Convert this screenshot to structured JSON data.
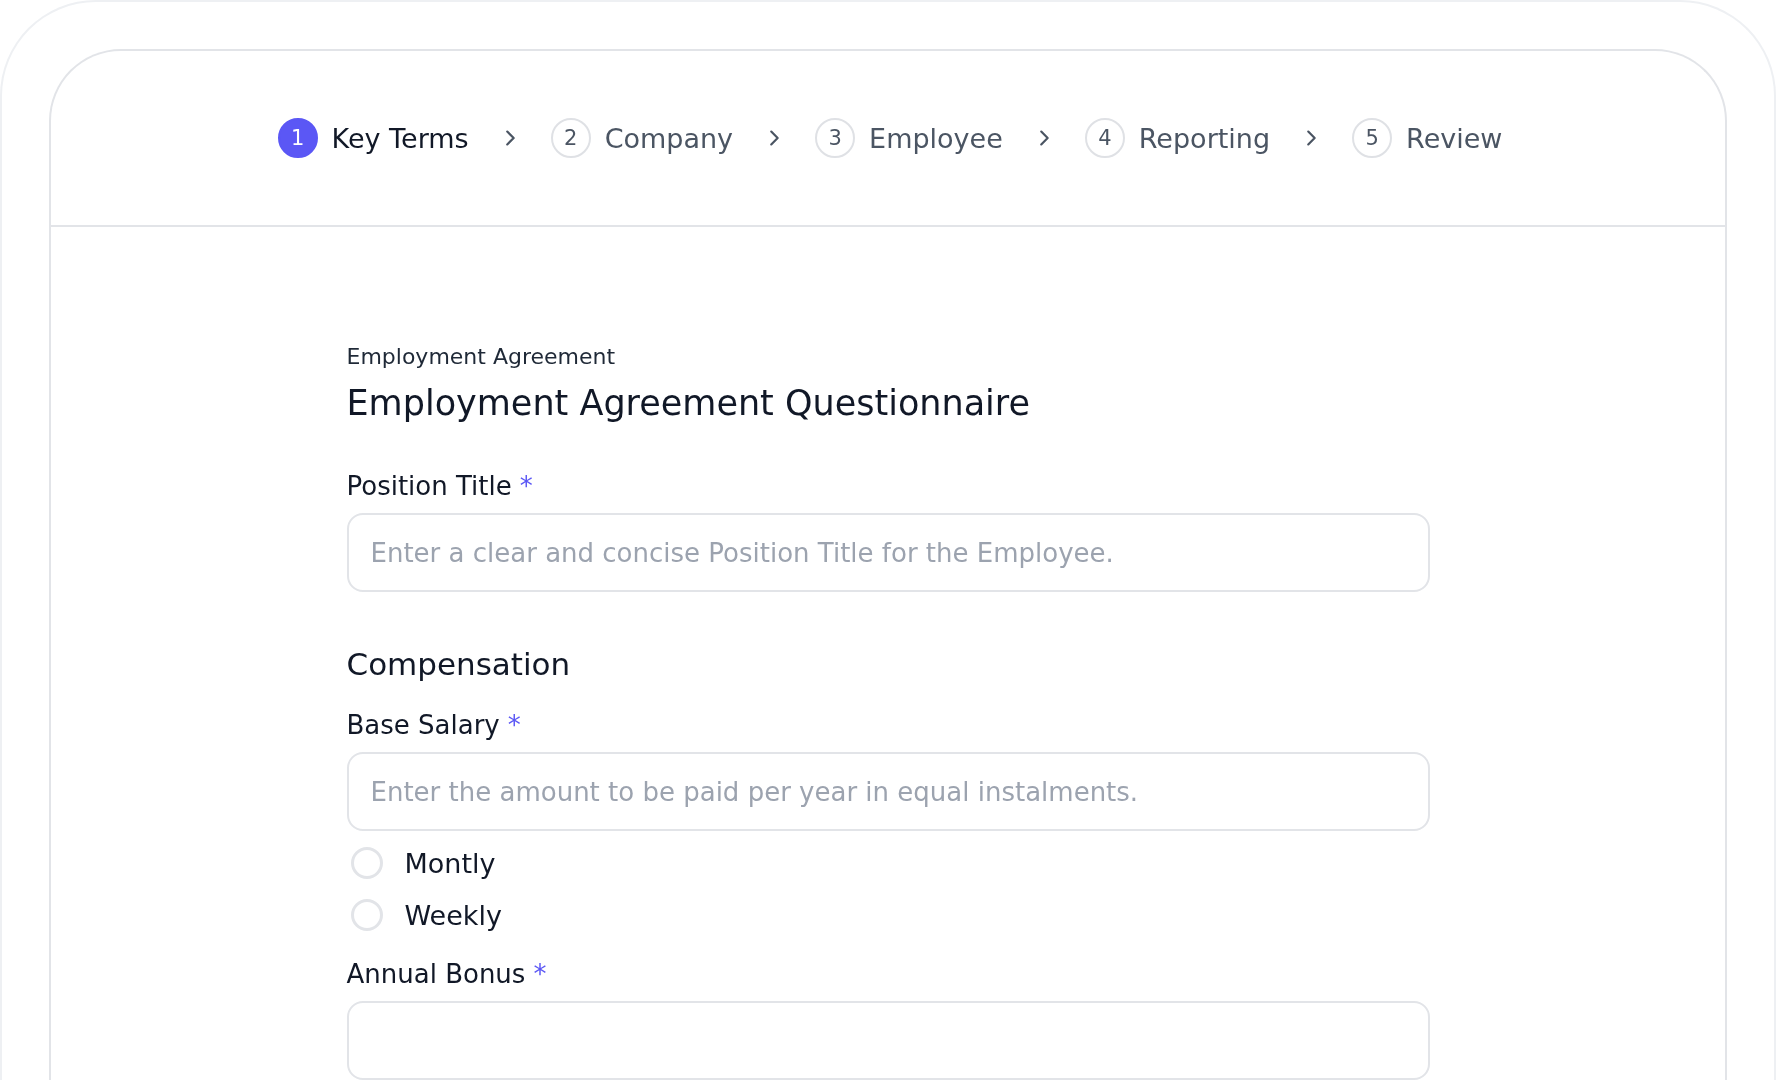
{
  "steps": [
    {
      "number": "1",
      "label": "Key Terms",
      "selected": true
    },
    {
      "number": "2",
      "label": "Company",
      "selected": false
    },
    {
      "number": "3",
      "label": "Employee",
      "selected": false
    },
    {
      "number": "4",
      "label": "Reporting",
      "selected": false
    },
    {
      "number": "5",
      "label": "Review",
      "selected": false
    }
  ],
  "form": {
    "eyebrow": "Employment Agreement",
    "title": "Employment Agreement Questionnaire",
    "fields": [
      {
        "kind": "input",
        "label": "Position Title",
        "required_mark": "*",
        "placeholder": "Enter a clear and concise Position Title for the Employee."
      },
      {
        "kind": "heading",
        "label": "Compensation"
      },
      {
        "kind": "input",
        "label": "Base Salary",
        "required_mark": "*",
        "placeholder": "Enter the amount to be paid per year in equal instalments.",
        "options": [
          {
            "label": "Montly",
            "selected": false
          },
          {
            "label": "Weekly",
            "selected": false
          }
        ]
      },
      {
        "kind": "input",
        "label": "Annual Bonus",
        "required_mark": "*"
      }
    ]
  }
}
